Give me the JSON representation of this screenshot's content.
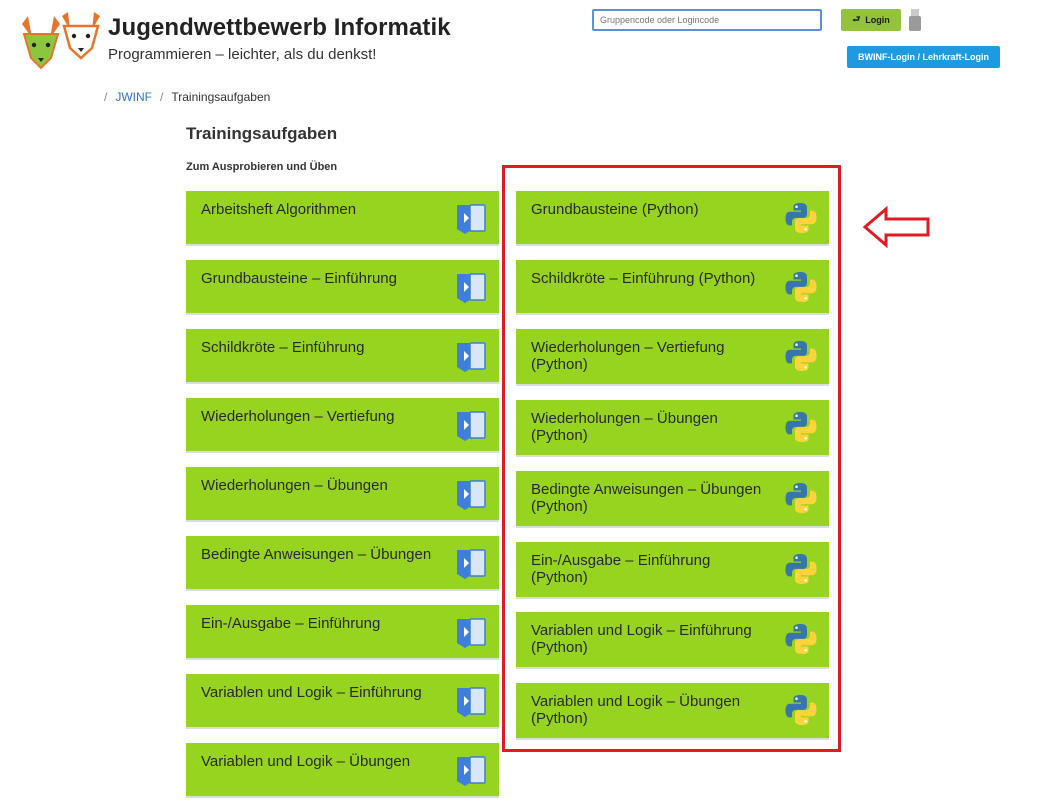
{
  "header": {
    "title": "Jugendwettbewerb Informatik",
    "subtitle": "Programmieren – leichter, als du denkst!",
    "logo_icon": "fox-logo-icon",
    "code_input": {
      "placeholder": "Gruppencode oder Logincode",
      "value": ""
    },
    "login_label": "Login",
    "bwinf_login_label": "BWINF-Login / Lehrkraft-Login",
    "colors": {
      "login_button": "#92c33a",
      "bwinf_button": "#1e9be0"
    }
  },
  "breadcrumb": {
    "sep": "/",
    "home": "JWINF",
    "current": "Trainingsaufgaben"
  },
  "main": {
    "title": "Trainingsaufgaben",
    "section_label": "Zum Ausprobieren und Üben",
    "card_color": "#97d420",
    "blockly_cards": [
      "Arbeitsheft Algorithmen",
      "Grundbausteine – Einführung",
      "Schildkröte – Einführung",
      "Wiederholungen – Vertiefung",
      "Wiederholungen – Übungen",
      "Bedingte Anweisungen – Übungen",
      "Ein-/Ausgabe – Einführung",
      "Variablen und Logik – Einführung",
      "Variablen und Logik – Übungen"
    ],
    "python_cards": [
      "Grundbausteine (Python)",
      "Schildkröte – Einführung (Python)",
      "Wiederholungen – Vertiefung (Python)",
      "Wiederholungen – Übungen (Python)",
      "Bedingte Anweisungen – Übungen (Python)",
      "Ein-/Ausgabe – Einführung (Python)",
      "Variablen und Logik – Einführung (Python)",
      "Variablen und Logik – Übungen (Python)"
    ],
    "icons": {
      "blockly": "blockly-icon",
      "python": "python-icon"
    }
  },
  "annotation": {
    "color": "#e01b24"
  }
}
